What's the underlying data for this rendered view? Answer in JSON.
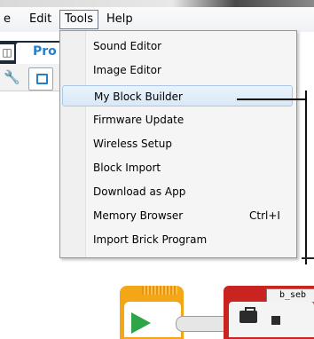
{
  "menubar": {
    "items": [
      {
        "label": "e"
      },
      {
        "label": "Edit"
      },
      {
        "label": "Tools"
      },
      {
        "label": "Help"
      }
    ]
  },
  "project_tab": {
    "label": "Pro"
  },
  "tools_menu": {
    "items": [
      {
        "label": "Sound Editor",
        "shortcut": ""
      },
      {
        "label": "Image Editor",
        "shortcut": ""
      },
      {
        "label": "My Block Builder",
        "shortcut": "",
        "highlighted": true
      },
      {
        "label": "Firmware Update",
        "shortcut": ""
      },
      {
        "label": "Wireless Setup",
        "shortcut": ""
      },
      {
        "label": "Block Import",
        "shortcut": ""
      },
      {
        "label": "Download as App",
        "shortcut": ""
      },
      {
        "label": "Memory Browser",
        "shortcut": "Ctrl+I"
      },
      {
        "label": "Import Brick Program",
        "shortcut": ""
      }
    ]
  },
  "canvas": {
    "my_block_name": "b_seb"
  },
  "icons": [
    "wrench-icon",
    "page-icon",
    "play-icon",
    "briefcase-icon"
  ],
  "colors": {
    "accent_blue": "#2a7fc4",
    "start_block": "#f3a716",
    "my_block": "#c9241f",
    "highlight": "#d9e8f7"
  }
}
